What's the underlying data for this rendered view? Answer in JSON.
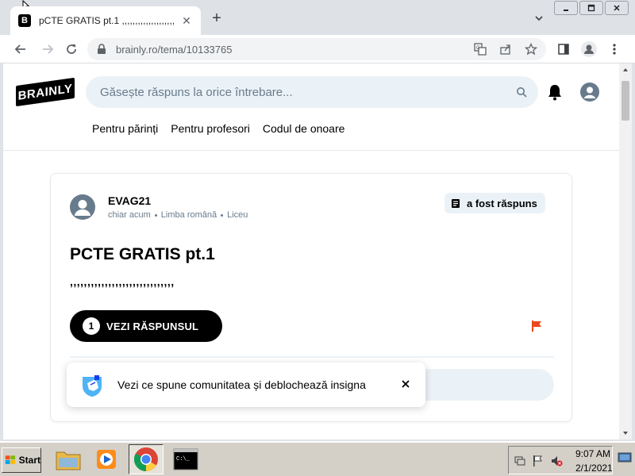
{
  "browser": {
    "tab": {
      "favicon": "B",
      "title": "pCTE GRATIS pt.1 ,,,,,,,,,,,,,,,,,,,,,,,,,,,"
    },
    "url": "brainly.ro/tema/10133765"
  },
  "site": {
    "logo": "BRAINLY",
    "search_placeholder": "Găsește răspuns la orice întrebare...",
    "nav": [
      "Pentru părinți",
      "Pentru profesori",
      "Codul de onoare"
    ]
  },
  "question": {
    "author": "EVAG21",
    "time": "chiar acum",
    "subject": "Limba română",
    "level": "Liceu",
    "status_badge": "a fost răspuns",
    "title": "PCTE GRATIS pt.1",
    "body": ",,,,,,,,,,,,,,,,,,,,,,,,,,,,,,",
    "answer_count": "1",
    "see_answer_label": "VEZI RĂSPUNSUL"
  },
  "toast": {
    "text": "Vezi ce spune comunitatea și deblochează insigna"
  },
  "taskbar": {
    "start_label": "Start",
    "clock_time": "9:07 AM",
    "clock_date": "2/1/2021"
  },
  "colors": {
    "flag": "#e8481c",
    "search_bg": "#ebf2f7",
    "button_bg": "#000000"
  }
}
